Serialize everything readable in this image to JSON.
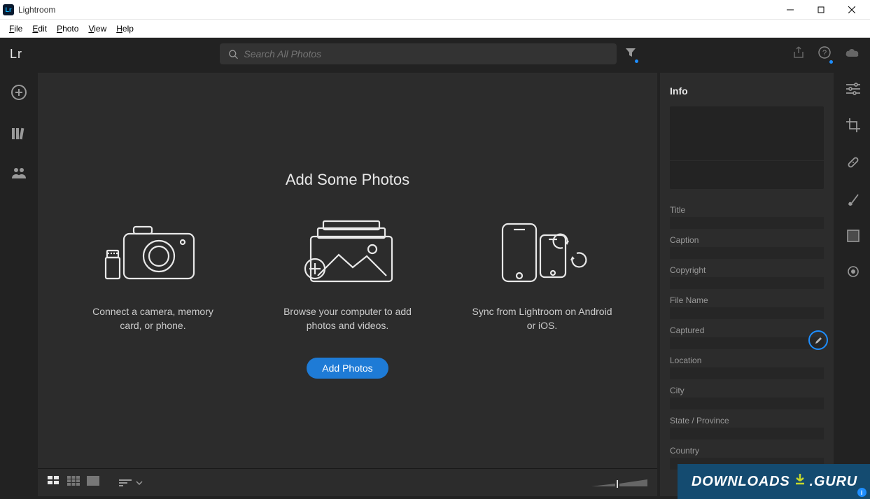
{
  "window": {
    "title": "Lightroom",
    "app_icon_text": "Lr"
  },
  "menubar": [
    {
      "label": "File",
      "mnemonic": "F"
    },
    {
      "label": "Edit",
      "mnemonic": "E"
    },
    {
      "label": "Photo",
      "mnemonic": "P"
    },
    {
      "label": "View",
      "mnemonic": "V"
    },
    {
      "label": "Help",
      "mnemonic": "H"
    }
  ],
  "topbar": {
    "logo": "Lr",
    "search_placeholder": "Search All Photos"
  },
  "onboarding": {
    "heading": "Add Some Photos",
    "cards": [
      {
        "caption": "Connect a camera, memory card, or phone."
      },
      {
        "caption": "Browse your computer to add photos and videos."
      },
      {
        "caption": "Sync from Lightroom on Android or iOS."
      }
    ],
    "add_button": "Add Photos"
  },
  "info_panel": {
    "title": "Info",
    "fields": [
      "Title",
      "Caption",
      "Copyright",
      "File Name",
      "Captured",
      "Location",
      "City",
      "State / Province",
      "Country"
    ]
  },
  "watermark": {
    "left": "DOWNLOADS",
    "right": ".GURU"
  }
}
